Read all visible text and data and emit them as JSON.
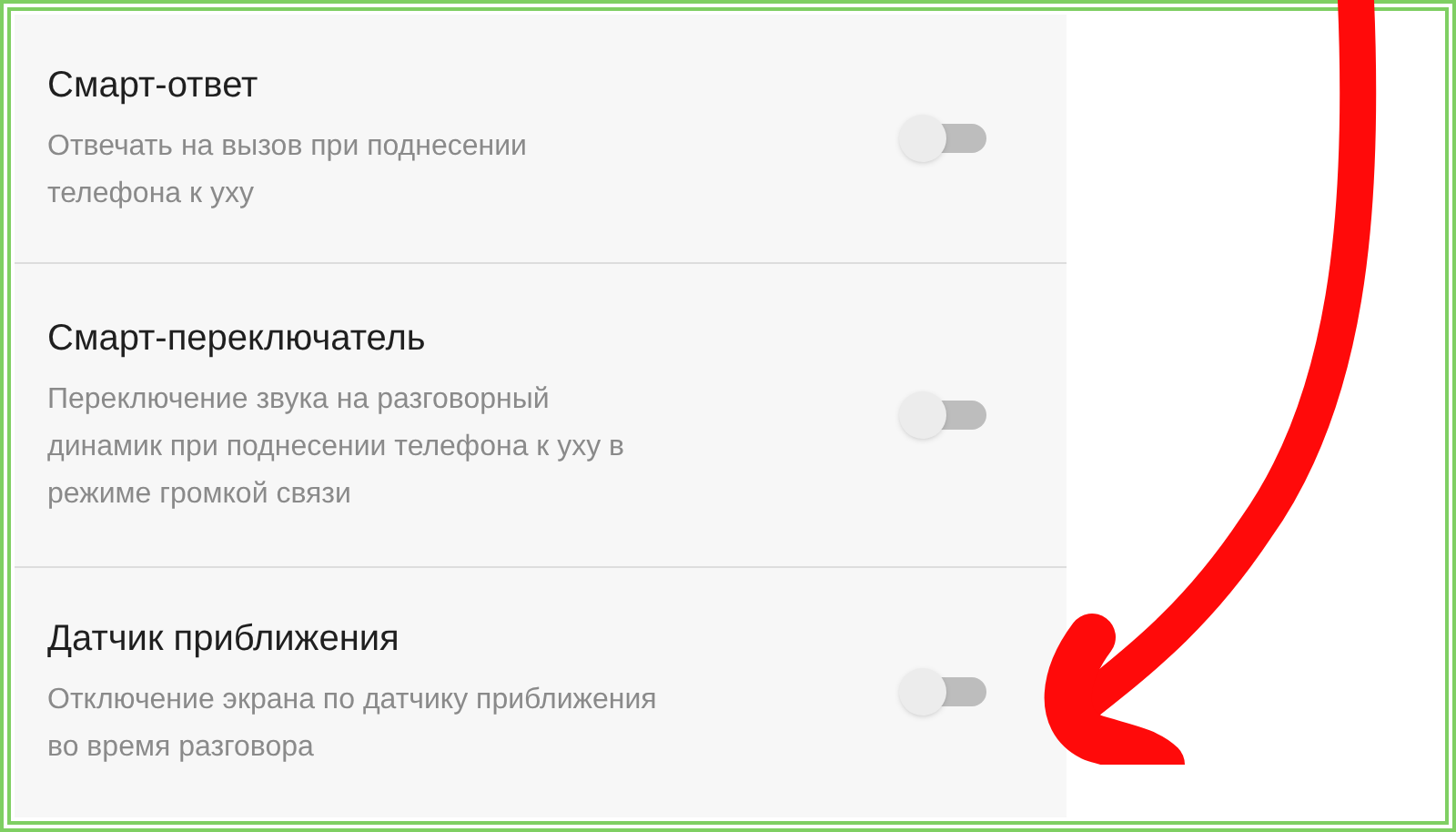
{
  "settings": [
    {
      "title": "Смарт-ответ",
      "description": "Отвечать на вызов при поднесении\nтелефона к уху",
      "on": false
    },
    {
      "title": "Смарт-переключатель",
      "description": "Переключение звука на разговорный\nдинамик при поднесении телефона к уху в\nрежиме громкой связи",
      "on": false
    },
    {
      "title": "Датчик приближения",
      "description": "Отключение экрана по датчику приближения\nво время разговора",
      "on": false
    }
  ]
}
